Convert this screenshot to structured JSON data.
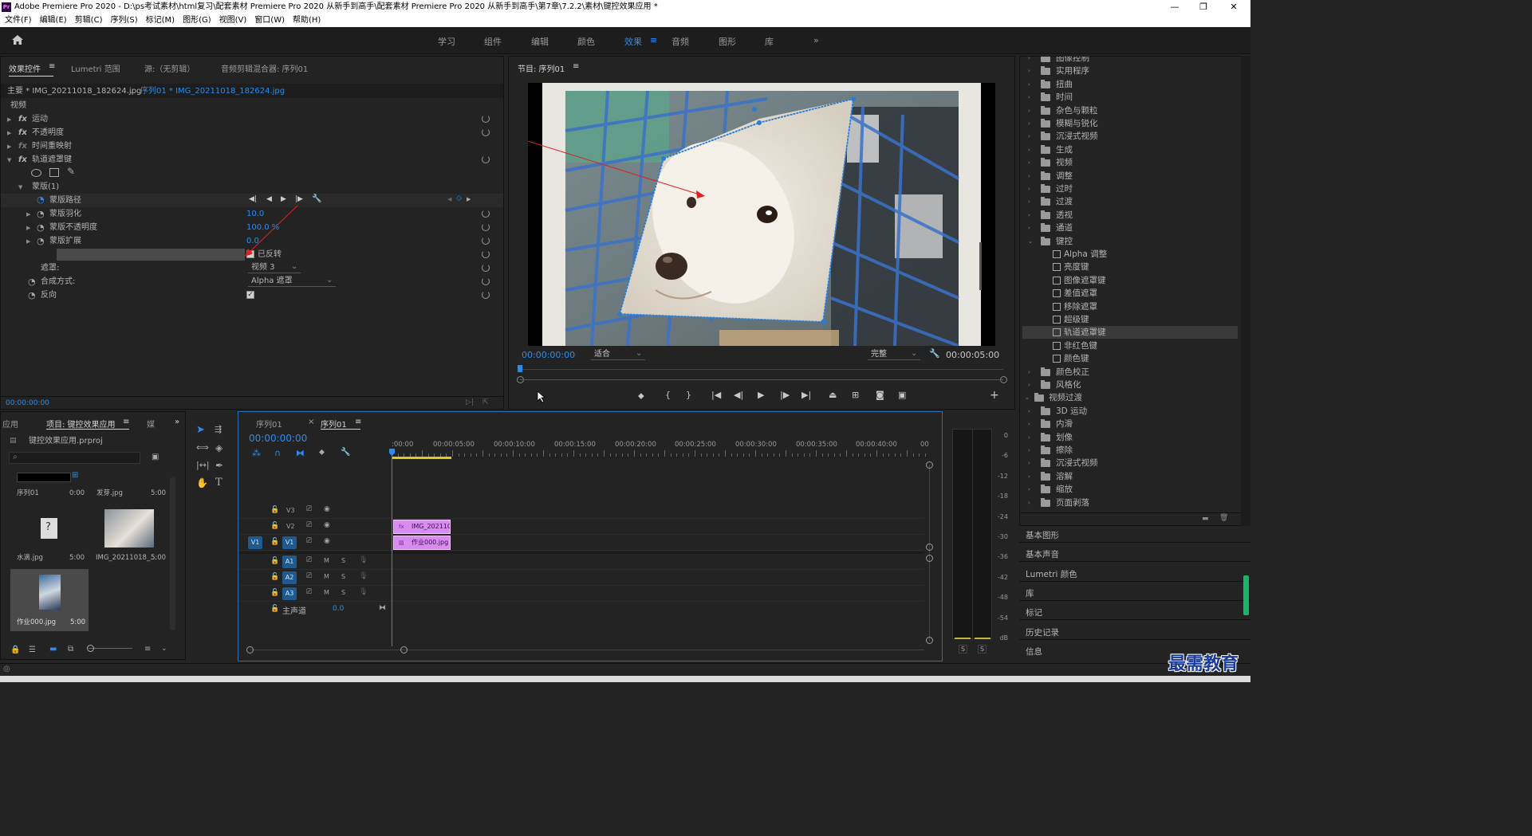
{
  "titlebar": {
    "app_icon": "Pr",
    "title": "Adobe Premiere Pro 2020 - D:\\ps考试素材\\html复习\\配套素材 Premiere Pro 2020 从新手到高手\\配套素材 Premiere Pro 2020 从新手到高手\\第7章\\7.2.2\\素材\\键控效果应用 *"
  },
  "menubar": [
    "文件(F)",
    "编辑(E)",
    "剪辑(C)",
    "序列(S)",
    "标记(M)",
    "图形(G)",
    "视图(V)",
    "窗口(W)",
    "帮助(H)"
  ],
  "workspaces": {
    "items": [
      "学习",
      "组件",
      "编辑",
      "颜色",
      "效果",
      "音频",
      "图形",
      "库"
    ],
    "active": "效果",
    "more": "»"
  },
  "effect_controls": {
    "tabs": [
      "效果控件",
      "Lumetri 范围",
      "源:（无剪辑）",
      "音频剪辑混合器: 序列01"
    ],
    "master": "主要 * IMG_20211018_182624.jpg",
    "clip": "序列01 * IMG_20211018_182624.jpg",
    "section_video": "视频",
    "fx": [
      "运动",
      "不透明度",
      "时间重映射",
      "轨道遮罩键"
    ],
    "mask": "蒙版(1)",
    "mask_path": "蒙版路径",
    "props": [
      {
        "label": "蒙版羽化",
        "value": "10.0"
      },
      {
        "label": "蒙版不透明度",
        "value": "100.0 %"
      },
      {
        "label": "蒙版扩展",
        "value": "0.0"
      }
    ],
    "inverted_label": "已反转",
    "matte_label": "遮罩:",
    "matte_value": "视频 3",
    "composite_label": "合成方式:",
    "composite_value": "Alpha 遮罩",
    "reverse_label": "反向",
    "timecode": "00:00:00:00"
  },
  "program": {
    "title": "节目: 序列01",
    "timecode": "00:00:00:00",
    "fit": "适合",
    "quality": "完整",
    "duration": "00:00:05:00"
  },
  "effects_tree": {
    "top_items": [
      "图像控制",
      "实用程序",
      "扭曲",
      "时间",
      "杂色与颗粒",
      "模糊与锐化",
      "沉浸式视频",
      "生成",
      "视频",
      "调整",
      "过时",
      "过渡",
      "透视",
      "通道"
    ],
    "keying_folder": "键控",
    "keying_items": [
      "Alpha 调整",
      "亮度键",
      "图像遮罩键",
      "差值遮罩",
      "移除遮罩",
      "超级键",
      "轨道遮罩键",
      "非红色键",
      "颜色键"
    ],
    "selected": "轨道遮罩键",
    "after_items": [
      "颜色校正",
      "风格化"
    ],
    "transitions_folder": "视频过渡",
    "transition_items": [
      "3D 运动",
      "内滑",
      "划像",
      "擦除",
      "沉浸式视频",
      "溶解",
      "缩放",
      "页面剥落"
    ],
    "sections": [
      "基本图形",
      "基本声音",
      "Lumetri 颜色",
      "库",
      "标记",
      "历史记录",
      "信息"
    ]
  },
  "project": {
    "tabs": [
      "应用",
      "项目: 键控效果应用",
      "媒"
    ],
    "file": "键控效果应用.prproj",
    "items": [
      {
        "name": "序列01",
        "dur": "0:00"
      },
      {
        "name": "发芽.jpg",
        "dur": "5:00"
      },
      {
        "name": "水滴.jpg",
        "dur": "5:00"
      },
      {
        "name": "IMG_20211018_...",
        "dur": "5:00"
      },
      {
        "name": "作业000.jpg",
        "dur": "5:00"
      }
    ]
  },
  "timeline": {
    "tabs": [
      "序列01",
      "序列01"
    ],
    "timecode": "00:00:00:00",
    "ruler": [
      ":00:00",
      "00:00:05:00",
      "00:00:10:00",
      "00:00:15:00",
      "00:00:20:00",
      "00:00:25:00",
      "00:00:30:00",
      "00:00:35:00",
      "00:00:40:00",
      "00"
    ],
    "video_tracks": [
      "V3",
      "V2",
      "V1"
    ],
    "audio_tracks": [
      "A1",
      "A2",
      "A3"
    ],
    "master": "主声道",
    "master_value": "0.0",
    "source_patch": "V1",
    "clips": [
      {
        "track": "V2",
        "label": "IMG_202110"
      },
      {
        "track": "V1",
        "label": "作业000.jpg"
      }
    ]
  },
  "meter": {
    "labels": [
      "0",
      "-6",
      "-12",
      "-18",
      "-24",
      "-30",
      "-36",
      "-42",
      "-48",
      "-54",
      "dB"
    ],
    "solo": [
      "S",
      "S"
    ]
  },
  "watermark": "最需教育",
  "colors": {
    "accent": "#2d8ceb",
    "clip": "#d98cf0",
    "panel": "#232323"
  }
}
